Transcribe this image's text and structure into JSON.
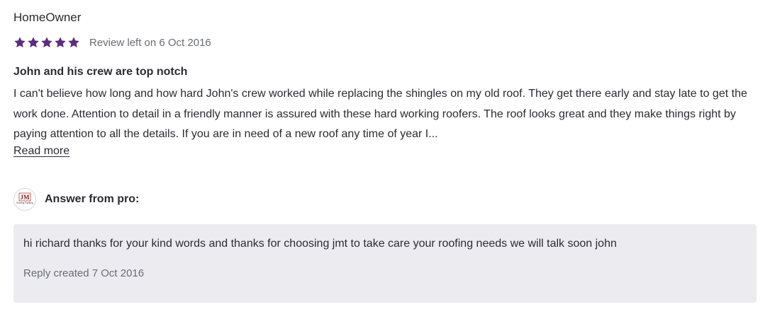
{
  "review": {
    "author": "HomeOwner",
    "rating": 5,
    "max_rating": 5,
    "star_color": "#5b2d82",
    "date_text": "Review left on 6 Oct 2016",
    "title": "John and his crew are top notch",
    "body": "I can't believe how long and how hard John's crew worked while replacing the shingles on my old roof. They get there early and stay late to get the work done. Attention to detail in a friendly manner is assured with these hard working roofers. The roof looks great and they make things right by paying attention to all the details. If you are in need of a new roof any time of year I...",
    "read_more_label": "Read more"
  },
  "answer": {
    "label": "Answer from pro:",
    "logo_icon": "jmt-roofing-logo",
    "logo_text": "JM",
    "logo_subtext": "Roofing Painting",
    "text": "hi richard thanks for your kind words and thanks for choosing jmt to take care your roofing needs we will talk soon john",
    "reply_date_text": "Reply created 7 Oct 2016"
  }
}
